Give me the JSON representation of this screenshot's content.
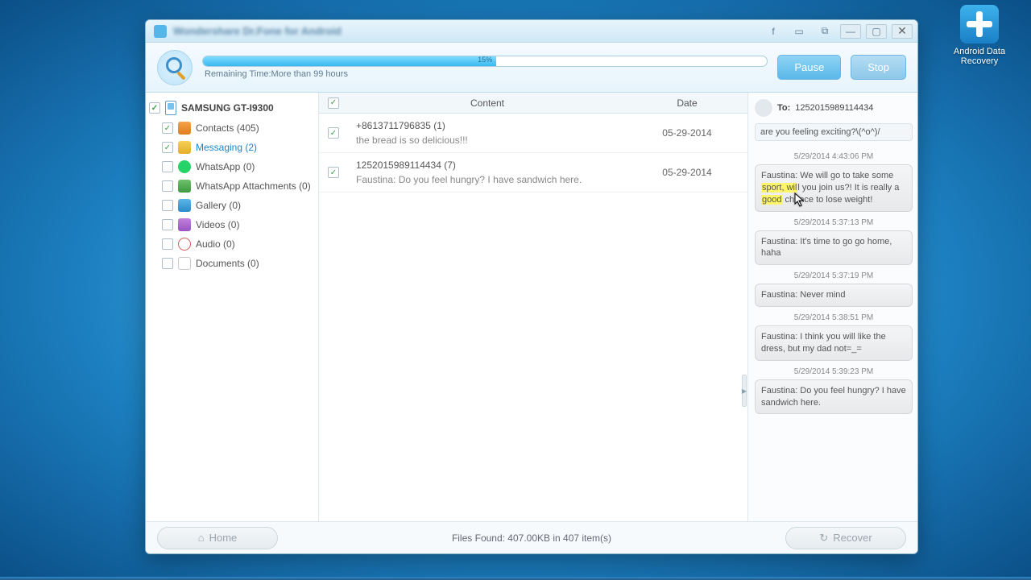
{
  "desktop": {
    "icon_label_1": "Android Data",
    "icon_label_2": "Recovery"
  },
  "title": "Wondershare Dr.Fone for Android",
  "scan": {
    "pct_text": "15%",
    "pct_fill_css": "52%",
    "remaining_prefix": "Remaining Time:",
    "remaining_value": "More than 99 hours",
    "pause": "Pause",
    "stop": "Stop"
  },
  "tree": {
    "device": "SAMSUNG GT-I9300",
    "items": [
      {
        "label": "Contacts (405)",
        "icon": "ic-contacts",
        "checked": true,
        "active": false
      },
      {
        "label": "Messaging (2)",
        "icon": "ic-msg",
        "checked": true,
        "active": true
      },
      {
        "label": "WhatsApp (0)",
        "icon": "ic-wa",
        "checked": false,
        "active": false
      },
      {
        "label": "WhatsApp Attachments (0)",
        "icon": "ic-waatt",
        "checked": false,
        "active": false
      },
      {
        "label": "Gallery (0)",
        "icon": "ic-gallery",
        "checked": false,
        "active": false
      },
      {
        "label": "Videos (0)",
        "icon": "ic-video",
        "checked": false,
        "active": false
      },
      {
        "label": "Audio (0)",
        "icon": "ic-audio",
        "checked": false,
        "active": false
      },
      {
        "label": "Documents (0)",
        "icon": "ic-doc",
        "checked": false,
        "active": false
      }
    ]
  },
  "grid": {
    "head_content": "Content",
    "head_date": "Date",
    "rows": [
      {
        "title": "+8613711796835 (1)",
        "sub": "the bread is so delicious!!!",
        "date": "05-29-2014",
        "checked": true
      },
      {
        "title": "1252015989114434 (7)",
        "sub": "Faustina: Do you feel hungry? I have sandwich here.",
        "date": "05-29-2014",
        "checked": true
      }
    ]
  },
  "chat": {
    "to_label": "To:",
    "to_number": "1252015989114434",
    "top_snippet": "are you feeling exciting?\\(^o^)/",
    "msgs": [
      {
        "ts": "5/29/2014 4:43:06 PM",
        "text_pre": "Faustina: We will go to take some ",
        "hl1": "sport, wil",
        "mid": "l you join us?! It is really a ",
        "hl2": "good",
        "text_post": " chance to lose weight!"
      },
      {
        "ts": "5/29/2014 5:37:13 PM",
        "text": "Faustina: It's time to go go home, haha"
      },
      {
        "ts": "5/29/2014 5:37:19 PM",
        "text": "Faustina: Never mind"
      },
      {
        "ts": "5/29/2014 5:38:51 PM",
        "text": "Faustina: I think you will like the dress, but my dad not=_="
      },
      {
        "ts": "5/29/2014 5:39:23 PM",
        "text": "Faustina: Do you feel hungry? I have sandwich here."
      }
    ]
  },
  "footer": {
    "home": "Home",
    "status": "Files Found: 407.00KB in 407 item(s)",
    "recover": "Recover"
  }
}
